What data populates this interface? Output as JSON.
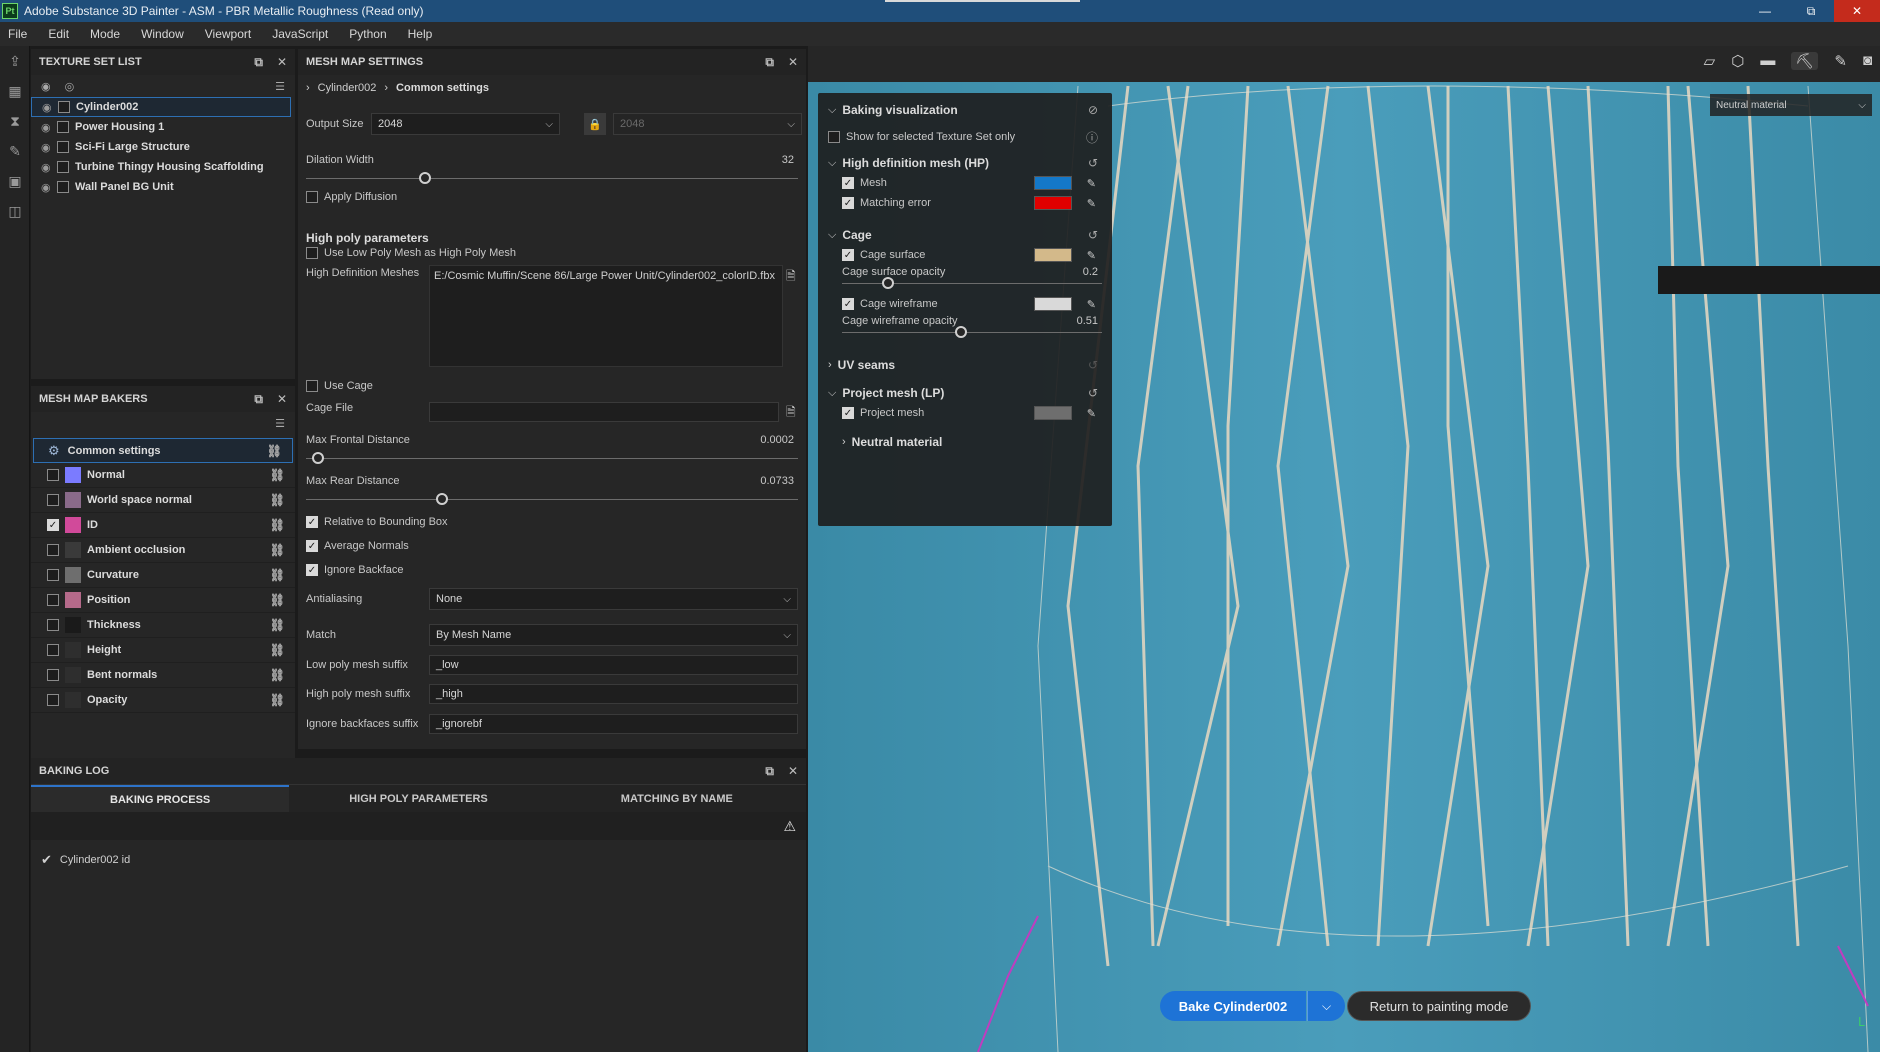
{
  "window": {
    "title": "Adobe Substance 3D Painter - ASM - PBR Metallic Roughness (Read only)",
    "app_icon_text": "Pt",
    "minimize": "—",
    "maximize": "⧉",
    "close": "✕"
  },
  "menu": [
    "File",
    "Edit",
    "Mode",
    "Window",
    "Viewport",
    "JavaScript",
    "Python",
    "Help"
  ],
  "texture_set_list": {
    "title": "TEXTURE SET LIST",
    "items": [
      {
        "label": "Cylinder002",
        "selected": true
      },
      {
        "label": "Power Housing 1"
      },
      {
        "label": "Sci-Fi Large Structure"
      },
      {
        "label": "Turbine Thingy Housing Scaffolding"
      },
      {
        "label": "Wall Panel BG Unit"
      }
    ]
  },
  "mesh_map_bakers": {
    "title": "MESH MAP BAKERS",
    "common": "Common settings",
    "items": [
      {
        "label": "Normal",
        "checked": false,
        "thumb": "#7b7bff"
      },
      {
        "label": "World space normal",
        "checked": false,
        "thumb": "#8a6b8a"
      },
      {
        "label": "ID",
        "checked": true,
        "thumb": "#d14a9a"
      },
      {
        "label": "Ambient occlusion",
        "checked": false,
        "thumb": "#3a3a3a"
      },
      {
        "label": "Curvature",
        "checked": false,
        "thumb": "#6e6e6e"
      },
      {
        "label": "Position",
        "checked": false,
        "thumb": "#b56a8a"
      },
      {
        "label": "Thickness",
        "checked": false,
        "thumb": "#1a1a1a"
      },
      {
        "label": "Height",
        "checked": false,
        "thumb": "#2e2e2e"
      },
      {
        "label": "Bent normals",
        "checked": false,
        "thumb": "#2e2e2e"
      },
      {
        "label": "Opacity",
        "checked": false,
        "thumb": "#2e2e2e"
      }
    ]
  },
  "mesh_map_settings": {
    "title": "MESH MAP SETTINGS",
    "breadcrumb": [
      "Cylinder002",
      "Common settings"
    ],
    "output_size_label": "Output Size",
    "output_size": "2048",
    "output_size_locked": "2048",
    "dilation_label": "Dilation Width",
    "dilation_value": "32",
    "apply_diffusion": "Apply Diffusion",
    "high_poly_title": "High poly parameters",
    "use_low_as_high": "Use Low Poly Mesh as High Poly Mesh",
    "hd_meshes_label": "High Definition Meshes",
    "hd_meshes_value": "E:/Cosmic Muffin/Scene 86/Large Power Unit/Cylinder002_colorID.fbx",
    "use_cage": "Use Cage",
    "cage_file_label": "Cage File",
    "max_frontal_label": "Max Frontal Distance",
    "max_frontal_value": "0.0002",
    "max_rear_label": "Max Rear Distance",
    "max_rear_value": "0.0733",
    "relative_bbox": "Relative to Bounding Box",
    "average_normals": "Average Normals",
    "ignore_backface": "Ignore Backface",
    "antialiasing_label": "Antialiasing",
    "antialiasing_value": "None",
    "match_label": "Match",
    "match_value": "By Mesh Name",
    "low_suffix_label": "Low poly mesh suffix",
    "low_suffix_value": "_low",
    "high_suffix_label": "High poly mesh suffix",
    "high_suffix_value": "_high",
    "ignore_suffix_label": "Ignore backfaces suffix",
    "ignore_suffix_value": "_ignorebf"
  },
  "baking_log": {
    "title": "BAKING LOG",
    "tabs": [
      "BAKING PROCESS",
      "HIGH POLY PARAMETERS",
      "MATCHING BY NAME"
    ],
    "entry": "Cylinder002 id"
  },
  "baking_visualization": {
    "title": "Baking visualization",
    "show_selected": "Show for selected Texture Set only",
    "hp_title": "High definition mesh (HP)",
    "mesh": "Mesh",
    "mesh_color": "#1478c8",
    "matching_error": "Matching error",
    "matching_error_color": "#e00000",
    "cage_title": "Cage",
    "cage_surface": "Cage surface",
    "cage_surface_color": "#d3b98a",
    "cage_surface_opacity_label": "Cage surface opacity",
    "cage_surface_opacity": "0.2",
    "cage_wireframe": "Cage wireframe",
    "cage_wireframe_color": "#d9d9d9",
    "cage_wireframe_opacity_label": "Cage wireframe opacity",
    "cage_wireframe_opacity": "0.51",
    "uv_seams": "UV seams",
    "lp_title": "Project mesh (LP)",
    "project_mesh": "Project mesh",
    "project_mesh_color": "#6e6e6e",
    "neutral_material": "Neutral material"
  },
  "viewport": {
    "material_dropdown": "Neutral material",
    "bake_button": "Bake Cylinder002",
    "return_button": "Return to painting mode"
  }
}
